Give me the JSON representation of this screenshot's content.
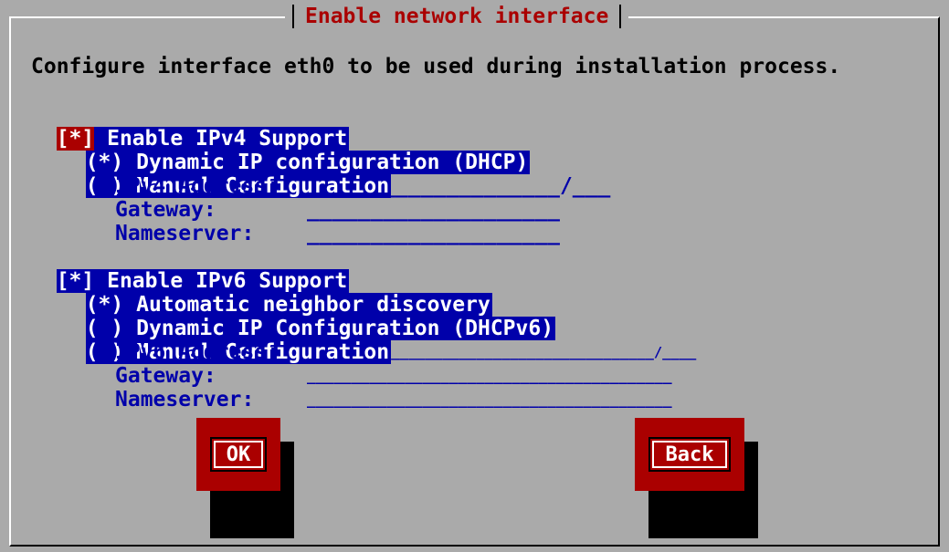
{
  "dialog": {
    "title": "Enable network interface",
    "description": "Configure interface eth0 to be used during installation process."
  },
  "ipv4": {
    "enable_mark": "[*]",
    "enable_label": " Enable IPv4 Support",
    "dhcp_mark": "(*)",
    "dhcp_label": " Dynamic IP configuration (DHCP)",
    "manual_mark": "( )",
    "manual_label": " Manual Configuration",
    "address_label": "IPv4 Address:",
    "address_value": "____________________/___",
    "gateway_label": "Gateway:",
    "gateway_value": "____________________",
    "nameserver_label": "Nameserver:",
    "nameserver_value": "____________________"
  },
  "ipv6": {
    "enable_mark": "[*]",
    "enable_label": " Enable IPv6 Support",
    "auto_mark": "(*)",
    "auto_label": " Automatic neighbor discovery",
    "dhcp_mark": "( )",
    "dhcp_label": " Dynamic IP Configuration (DHCPv6)",
    "manual_mark": "( )",
    "manual_label": " Manual Configuration",
    "address_label": "IPv6 Address:",
    "address_value": "_________________________________________/____",
    "gateway_label": "Gateway:",
    "gateway_value": "_________________________________________",
    "nameserver_label": "Nameserver:",
    "nameserver_value": "_________________________________________"
  },
  "buttons": {
    "ok": "OK",
    "back": "Back"
  },
  "colors": {
    "background": "#aaaaaa",
    "selection": "#0000aa",
    "accent": "#aa0000"
  }
}
